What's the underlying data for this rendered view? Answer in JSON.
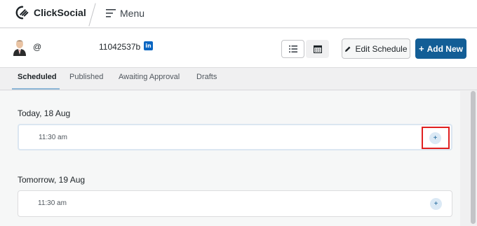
{
  "app": {
    "name": "ClickSocial",
    "menu_label": "Menu"
  },
  "account": {
    "handle_prefix": "@",
    "id": "11042537b",
    "network_badge": "in",
    "network_icon": "linkedin-icon"
  },
  "toolbar": {
    "edit_label": "Edit Schedule",
    "add_plus": "+",
    "add_label": "Add New"
  },
  "tabs": [
    {
      "label": "Scheduled",
      "active": true
    },
    {
      "label": "Published",
      "active": false
    },
    {
      "label": "Awaiting Approval",
      "active": false
    },
    {
      "label": "Drafts",
      "active": false
    }
  ],
  "schedule": {
    "days": [
      {
        "title": "Today, 18 Aug",
        "slots": [
          {
            "time": "11:30 am",
            "add_symbol": "+"
          }
        ]
      },
      {
        "title": "Tomorrow, 19 Aug",
        "slots": [
          {
            "time": "11:30 am",
            "add_symbol": "+"
          }
        ]
      }
    ]
  },
  "colors": {
    "accent": "#135e96",
    "highlight_box": "#e02020",
    "linkedin": "#0a66c2"
  }
}
